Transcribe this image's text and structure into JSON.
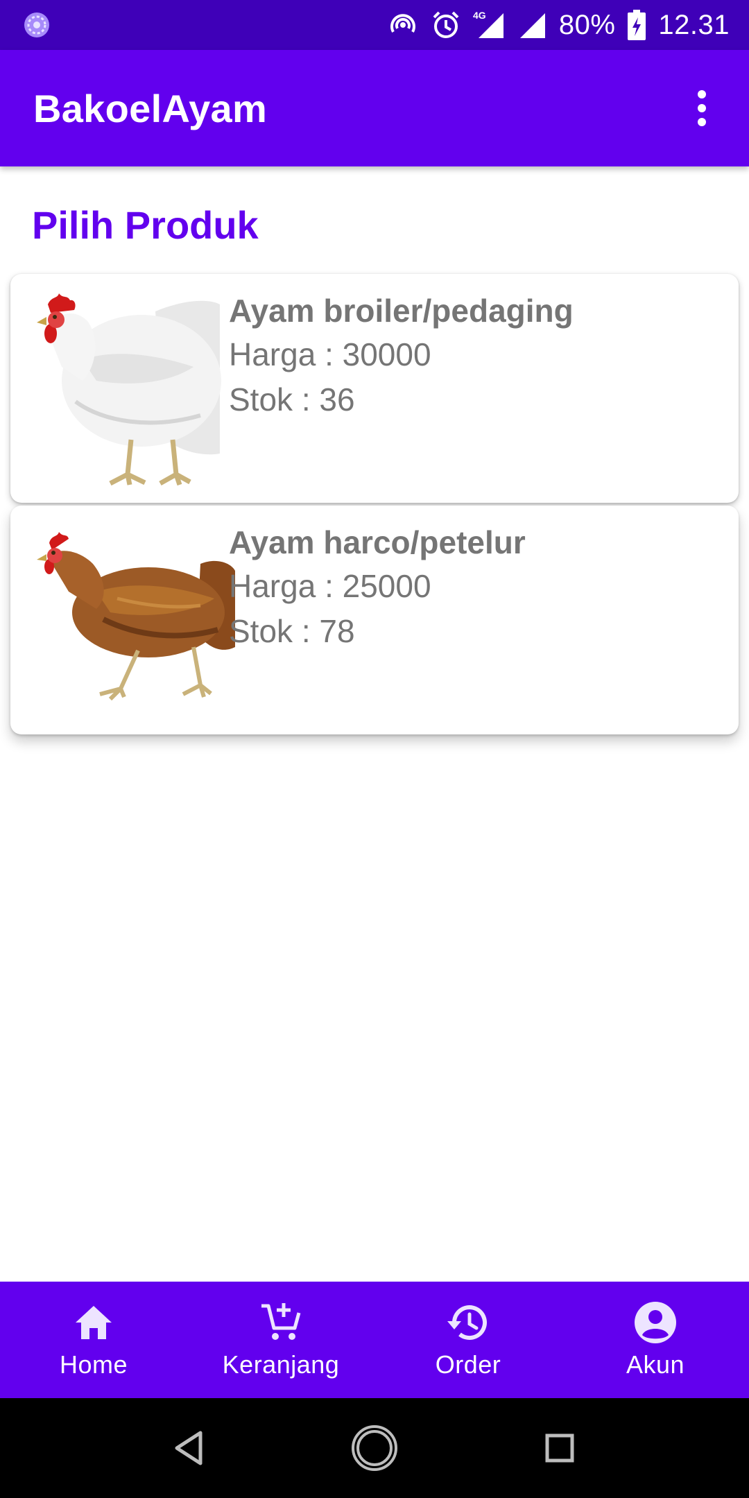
{
  "status_bar": {
    "battery": "80%",
    "time": "12.31",
    "network": "4G",
    "icons": [
      "notification-icon",
      "hotspot-icon",
      "alarm-icon",
      "signal-4g-icon",
      "signal-icon",
      "battery-charging-icon"
    ]
  },
  "app_bar": {
    "title": "BakoelAyam",
    "menu_icon": "more-vert-icon"
  },
  "main": {
    "section_title": "Pilih Produk",
    "products": [
      {
        "name": "Ayam broiler/pedaging",
        "price": "Harga : 30000",
        "stock": "Stok : 36",
        "image": "white-chicken-photo"
      },
      {
        "name": "Ayam harco/petelur",
        "price": "Harga : 25000",
        "stock": "Stok : 78",
        "image": "brown-hen-photo"
      }
    ]
  },
  "bottom_nav": {
    "items": [
      {
        "label": "Home",
        "icon": "home-icon"
      },
      {
        "label": "Keranjang",
        "icon": "add-cart-icon"
      },
      {
        "label": "Order",
        "icon": "history-icon"
      },
      {
        "label": "Akun",
        "icon": "account-icon"
      }
    ]
  },
  "colors": {
    "primary": "#6200ee",
    "primary_dark": "#3f00b8",
    "text_secondary": "#757575",
    "system_nav": "#000000"
  }
}
